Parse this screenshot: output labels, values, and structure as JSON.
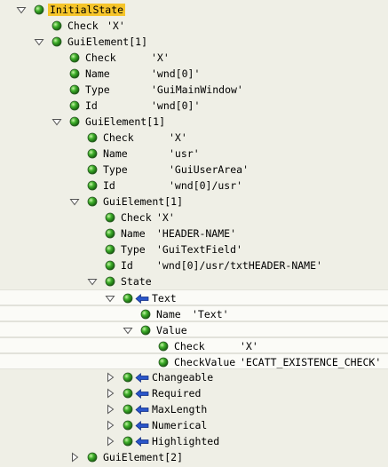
{
  "tree": [
    {
      "level": 0,
      "toggle": "expanded",
      "label": "InitialState",
      "value": "",
      "highlight": true
    },
    {
      "level": 1,
      "toggle": "none",
      "label": "Check",
      "value": "'X'",
      "valueX": 120
    },
    {
      "level": 1,
      "toggle": "expanded",
      "label": "GuiElement[1]",
      "value": ""
    },
    {
      "level": 2,
      "toggle": "none",
      "label": "Check",
      "value": "'X'",
      "valueX": 170
    },
    {
      "level": 2,
      "toggle": "none",
      "label": "Name",
      "value": "'wnd[0]'",
      "valueX": 170
    },
    {
      "level": 2,
      "toggle": "none",
      "label": "Type",
      "value": "'GuiMainWindow'",
      "valueX": 170
    },
    {
      "level": 2,
      "toggle": "none",
      "label": "Id",
      "value": "'wnd[0]'",
      "valueX": 170
    },
    {
      "level": 2,
      "toggle": "expanded",
      "label": "GuiElement[1]",
      "value": ""
    },
    {
      "level": 3,
      "toggle": "none",
      "label": "Check",
      "value": "'X'",
      "valueX": 190
    },
    {
      "level": 3,
      "toggle": "none",
      "label": "Name",
      "value": "'usr'",
      "valueX": 190
    },
    {
      "level": 3,
      "toggle": "none",
      "label": "Type",
      "value": "'GuiUserArea'",
      "valueX": 190
    },
    {
      "level": 3,
      "toggle": "none",
      "label": "Id",
      "value": "'wnd[0]/usr'",
      "valueX": 190
    },
    {
      "level": 3,
      "toggle": "expanded",
      "label": "GuiElement[1]",
      "value": ""
    },
    {
      "level": 4,
      "toggle": "none",
      "label": "Check",
      "value": "'X'",
      "valueX": 176
    },
    {
      "level": 4,
      "toggle": "none",
      "label": "Name",
      "value": "'HEADER-NAME'",
      "valueX": 176
    },
    {
      "level": 4,
      "toggle": "none",
      "label": "Type",
      "value": "'GuiTextField'",
      "valueX": 176
    },
    {
      "level": 4,
      "toggle": "none",
      "label": "Id",
      "value": "'wnd[0]/usr/txtHEADER-NAME'",
      "valueX": 176
    },
    {
      "level": 4,
      "toggle": "expanded",
      "label": "State",
      "value": ""
    },
    {
      "level": 5,
      "toggle": "expanded",
      "label": "Text",
      "value": "",
      "arrow": true,
      "band": true
    },
    {
      "level": 6,
      "toggle": "none",
      "label": "Name",
      "value": "'Text'",
      "valueX": 216,
      "band": true
    },
    {
      "level": 6,
      "toggle": "expanded",
      "label": "Value",
      "value": "",
      "band": true
    },
    {
      "level": 7,
      "toggle": "none",
      "label": "Check",
      "value": "'X'",
      "valueX": 270,
      "band": true
    },
    {
      "level": 7,
      "toggle": "none",
      "label": "CheckValue",
      "value": "'ECATT_EXISTENCE_CHECK'",
      "valueX": 270,
      "band": true
    },
    {
      "level": 5,
      "toggle": "collapsed",
      "label": "Changeable",
      "value": "",
      "arrow": true
    },
    {
      "level": 5,
      "toggle": "collapsed",
      "label": "Required",
      "value": "",
      "arrow": true
    },
    {
      "level": 5,
      "toggle": "collapsed",
      "label": "MaxLength",
      "value": "",
      "arrow": true
    },
    {
      "level": 5,
      "toggle": "collapsed",
      "label": "Numerical",
      "value": "",
      "arrow": true
    },
    {
      "level": 5,
      "toggle": "collapsed",
      "label": "Highlighted",
      "value": "",
      "arrow": true
    },
    {
      "level": 3,
      "toggle": "collapsed",
      "label": "GuiElement[2]",
      "value": ""
    }
  ]
}
